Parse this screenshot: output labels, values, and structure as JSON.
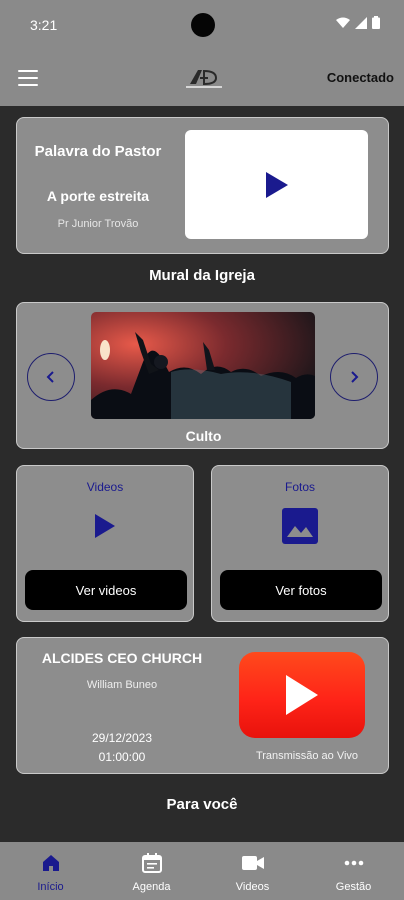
{
  "status_bar": {
    "time": "3:21"
  },
  "header": {
    "status_label": "Conectado"
  },
  "pastor_section": {
    "title": "Palavra do Pastor",
    "subtitle": "A porte estreita",
    "pastor_name": "Pr Junior Trovão"
  },
  "mural": {
    "title": "Mural da Igreja",
    "current_slide": "Culto"
  },
  "media": {
    "videos_label": "Videos",
    "videos_button": "Ver videos",
    "photos_label": "Fotos",
    "photos_button": "Ver fotos"
  },
  "live": {
    "title": "ALCIDES CEO CHURCH",
    "author": "William Buneo",
    "date": "29/12/2023",
    "time": "01:00:00",
    "label": "Transmissão ao Vivo"
  },
  "for_you": {
    "title": "Para você"
  },
  "bottom_nav": {
    "items": [
      {
        "label": "Início",
        "icon": "home-icon",
        "active": true
      },
      {
        "label": "Agenda",
        "icon": "calendar-icon",
        "active": false
      },
      {
        "label": "Videos",
        "icon": "video-camera-icon",
        "active": false
      },
      {
        "label": "Gestão",
        "icon": "more-icon",
        "active": false
      }
    ]
  },
  "colors": {
    "background": "#2b2b2b",
    "surface": "#8d8d8d",
    "accent": "#1a1a8e",
    "youtube_red": "#ff2418"
  }
}
